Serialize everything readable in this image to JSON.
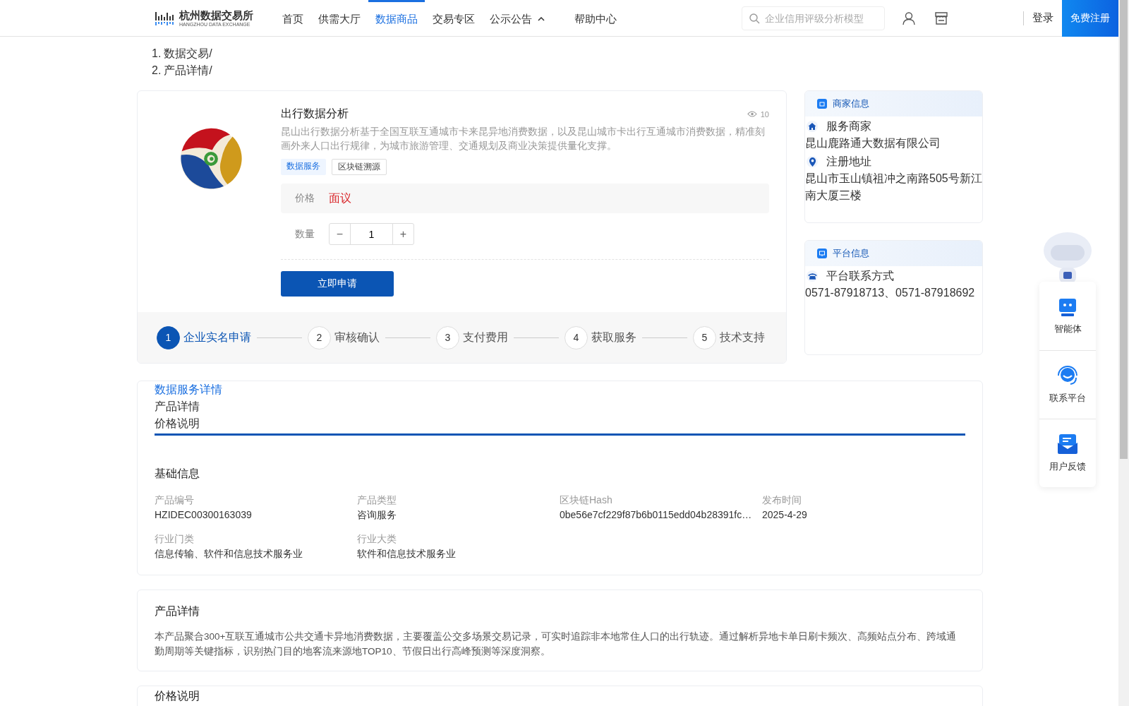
{
  "header": {
    "logo": {
      "name": "杭州数据交易所",
      "subtitle": "HANGZHOU DATA EXCHANGE"
    },
    "nav": [
      {
        "label": "首页",
        "selected": false
      },
      {
        "label": "供需大厅",
        "selected": false
      },
      {
        "label": "数据商品",
        "selected": true
      },
      {
        "label": "交易专区",
        "selected": false
      },
      {
        "label": "公示公告",
        "selected": false,
        "dropdown": true
      },
      {
        "label": "帮助中心",
        "selected": false
      }
    ],
    "search": {
      "placeholder": "企业信用评级分析模型"
    },
    "login": "登录",
    "register": "免费注册"
  },
  "breadcrumb": [
    {
      "marker": "1.",
      "label": "数据交易/"
    },
    {
      "marker": "2.",
      "label": "产品详情/"
    }
  ],
  "product": {
    "title": "出行数据分析",
    "views": "10",
    "description": "昆山出行数据分析基于全国互联互通城市卡来昆异地消费数据，以及昆山城市卡出行互通城市消费数据，精准刻画外来人口出行规律，为城市旅游管理、交通规划及商业决策提供量化支撑。",
    "tags": [
      {
        "label": "数据服务",
        "kind": "primary"
      },
      {
        "label": "区块链溯源",
        "kind": "plain"
      }
    ],
    "price_label": "价格",
    "price": "面议",
    "quantity_label": "数量",
    "quantity": "1",
    "minus": "−",
    "plus": "+",
    "apply": "立即申请",
    "steps": [
      {
        "number": "1",
        "label": "企业实名申请",
        "active": true
      },
      {
        "number": "2",
        "label": "审核确认",
        "active": false
      },
      {
        "number": "3",
        "label": "支付费用",
        "active": false
      },
      {
        "number": "4",
        "label": "获取服务",
        "active": false
      },
      {
        "number": "5",
        "label": "技术支持",
        "active": false
      }
    ]
  },
  "merchant": {
    "title": "商家信息",
    "items": [
      {
        "label": "服务商家",
        "value": "昆山鹿路通大数据有限公司"
      },
      {
        "label": "注册地址",
        "value": "昆山市玉山镇祖冲之南路505号新江南大厦三楼"
      }
    ]
  },
  "platform": {
    "title": "平台信息",
    "items": [
      {
        "label": "平台联系方式",
        "value": "0571-87918713、0571-87918692"
      }
    ]
  },
  "details": {
    "tabs": [
      {
        "label": "数据服务详情",
        "selected": true
      },
      {
        "label": "产品详情",
        "selected": false
      },
      {
        "label": "价格说明",
        "selected": false
      }
    ],
    "basic_title": "基础信息",
    "fields": [
      {
        "label": "产品编号",
        "value": "HZIDEC00300163039"
      },
      {
        "label": "产品类型",
        "value": "咨询服务"
      },
      {
        "label": "区块链Hash",
        "value": "0be56e7cf229f87b6b0115edd04b28391fc…"
      },
      {
        "label": "发布时间",
        "value": "2025-4-29"
      },
      {
        "label": "行业门类",
        "value": "信息传输、软件和信息技术服务业"
      },
      {
        "label": "行业大类",
        "value": "软件和信息技术服务业"
      }
    ]
  },
  "product_detail": {
    "title": "产品详情",
    "text": "本产品聚合300+互联互通城市公共交通卡异地消费数据，主要覆盖公交多场景交易记录，可实时追踪非本地常住人口的出行轨迹。通过解析异地卡单日刷卡频次、高频站点分布、跨域通勤周期等关键指标，识别热门目的地客流来源地TOP10、节假日出行高峰预测等深度洞察。"
  },
  "price_note": {
    "title": "价格说明"
  },
  "side_panel": [
    {
      "label": "智能体"
    },
    {
      "label": "联系平台"
    },
    {
      "label": "用户反馈"
    }
  ]
}
